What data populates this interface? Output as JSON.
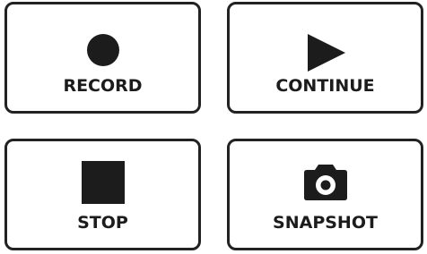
{
  "buttons": {
    "record": {
      "label": "RECORD",
      "icon": "record-circle-icon"
    },
    "continue": {
      "label": "CONTINUE",
      "icon": "play-triangle-icon"
    },
    "stop": {
      "label": "STOP",
      "icon": "stop-square-icon"
    },
    "snapshot": {
      "label": "SNAPSHOT",
      "icon": "camera-icon"
    }
  },
  "colors": {
    "border": "#222222",
    "icon": "#1c1c1c",
    "background": "#ffffff"
  }
}
